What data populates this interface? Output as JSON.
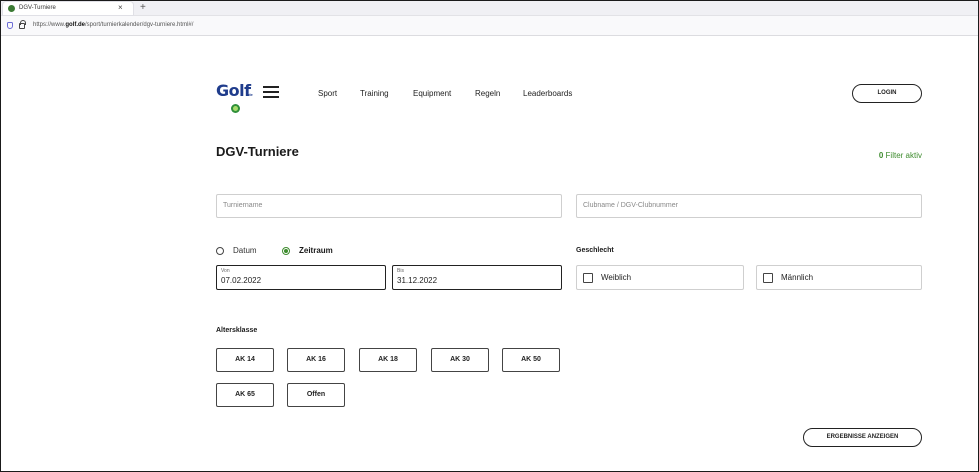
{
  "browser": {
    "tab_title": "DGV-Turniere",
    "tab_close": "×",
    "new_tab": "+",
    "url_prefix": "https://www.",
    "url_domain": "golf.de",
    "url_path": "/sport/turnierkalender/dgv-turniere.html#/"
  },
  "header": {
    "logo_text": "Golf",
    "logo_sup": ".de",
    "nav": [
      "Sport",
      "Training",
      "Equipment",
      "Regeln",
      "Leaderboards"
    ],
    "login_label": "LOGIN"
  },
  "main": {
    "title": "DGV-Turniere",
    "filter_count": "0",
    "filter_label": "Filter aktiv",
    "search": {
      "turnier_placeholder": "Turniername",
      "club_placeholder": "Clubname / DGV-Clubnummer"
    },
    "date_mode": {
      "options": [
        "Datum",
        "Zeitraum"
      ],
      "selected": "Zeitraum"
    },
    "date_range": {
      "from_label": "Von",
      "from_value": "07.02.2022",
      "to_label": "Bis",
      "to_value": "31.12.2022"
    },
    "gender": {
      "label": "Geschlecht",
      "options": [
        "Weiblich",
        "Männlich"
      ]
    },
    "age_class": {
      "label": "Altersklasse",
      "options": [
        "AK 14",
        "AK 16",
        "AK 18",
        "AK 30",
        "AK 50",
        "AK 65",
        "Offen"
      ]
    },
    "results_button": "ERGEBNISSE ANZEIGEN"
  },
  "colors": {
    "accent_green": "#3f8c2f",
    "logo_blue": "#1f3c8c"
  }
}
